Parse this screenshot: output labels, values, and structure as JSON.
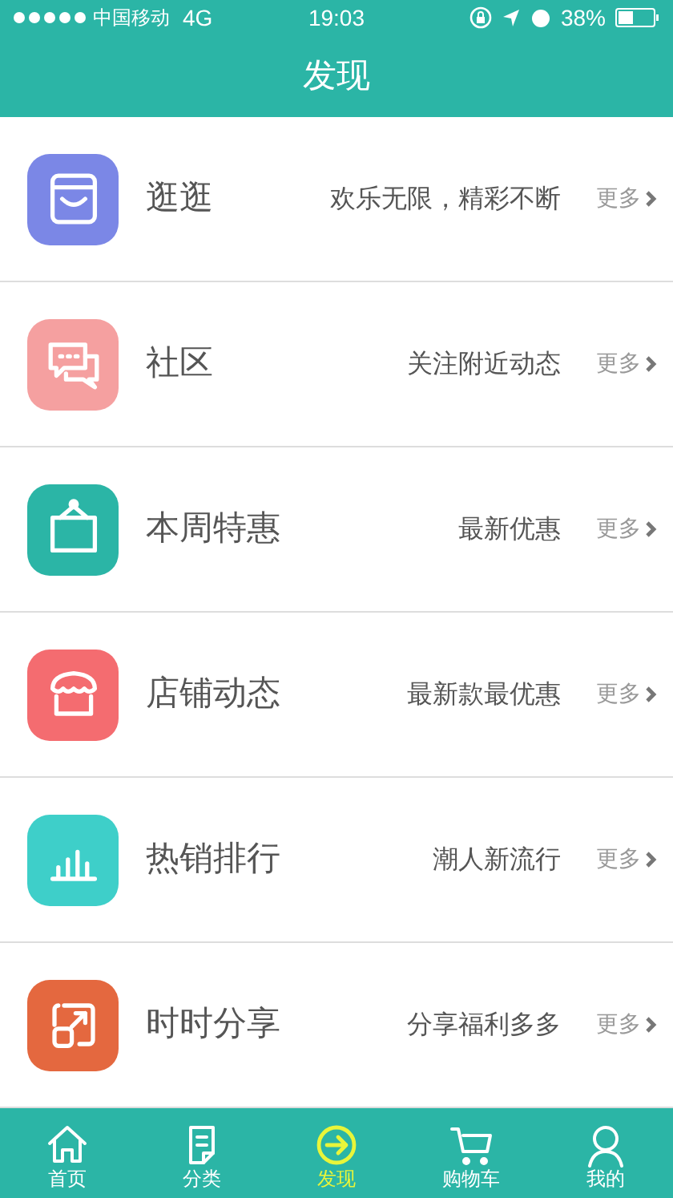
{
  "status_bar": {
    "carrier": "中国移动",
    "network": "4G",
    "time": "19:03",
    "battery": "38%"
  },
  "header": {
    "title": "发现"
  },
  "rows": [
    {
      "title": "逛逛",
      "subtitle": "欢乐无限，精彩不断",
      "more": "更多",
      "color": "#7b87e6"
    },
    {
      "title": "社区",
      "subtitle": "关注附近动态",
      "more": "更多",
      "color": "#f5a0a0"
    },
    {
      "title": "本周特惠",
      "subtitle": "最新优惠",
      "more": "更多",
      "color": "#2bb5a6"
    },
    {
      "title": "店铺动态",
      "subtitle": "最新款最优惠",
      "more": "更多",
      "color": "#f46c70"
    },
    {
      "title": "热销排行",
      "subtitle": "潮人新流行",
      "more": "更多",
      "color": "#3ecfc9"
    },
    {
      "title": "时时分享",
      "subtitle": "分享福利多多",
      "more": "更多",
      "color": "#e4683f"
    }
  ],
  "tab_bar": [
    {
      "label": "首页",
      "selected": false
    },
    {
      "label": "分类",
      "selected": false
    },
    {
      "label": "发现",
      "selected": true
    },
    {
      "label": "购物车",
      "selected": false
    },
    {
      "label": "我的",
      "selected": false
    }
  ]
}
